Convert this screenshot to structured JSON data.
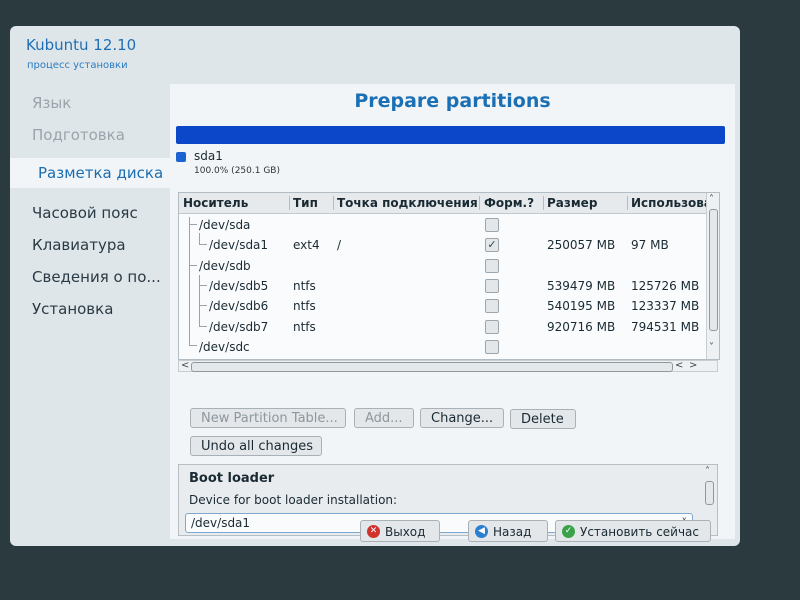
{
  "app": {
    "title": "Kubuntu 12.10",
    "subtitle": "процесс установки"
  },
  "sidebar": {
    "items": [
      {
        "label": "Язык",
        "state": "done"
      },
      {
        "label": "Подготовка",
        "state": "done"
      },
      {
        "label": "Разметка диска",
        "state": "active"
      },
      {
        "label": "Часовой пояс",
        "state": "pending"
      },
      {
        "label": "Клавиатура",
        "state": "pending"
      },
      {
        "label": "Сведения о по...",
        "state": "pending"
      },
      {
        "label": "Установка",
        "state": "pending"
      }
    ]
  },
  "main": {
    "title": "Prepare partitions",
    "usage_bar": {
      "color": "#0c47c9",
      "fill": 1.0
    },
    "legend": {
      "name": "sda1",
      "size": "100.0% (250.1 GB)",
      "color": "#1b63d0"
    },
    "table": {
      "headers": [
        "Носитель",
        "Тип",
        "Точка подключения",
        "Форм.?",
        "Размер",
        "Использова"
      ],
      "rows": [
        {
          "device": "/dev/sda",
          "type": "",
          "mount": "",
          "format": false,
          "size": "",
          "used": ""
        },
        {
          "device": "/dev/sda1",
          "type": "ext4",
          "mount": "/",
          "format": true,
          "size": "250057 MB",
          "used": "97 MB"
        },
        {
          "device": "/dev/sdb",
          "type": "",
          "mount": "",
          "format": false,
          "size": "",
          "used": ""
        },
        {
          "device": "/dev/sdb5",
          "type": "ntfs",
          "mount": "",
          "format": false,
          "size": "539479 MB",
          "used": "125726 MB"
        },
        {
          "device": "/dev/sdb6",
          "type": "ntfs",
          "mount": "",
          "format": false,
          "size": "540195 MB",
          "used": "123337 MB"
        },
        {
          "device": "/dev/sdb7",
          "type": "ntfs",
          "mount": "",
          "format": false,
          "size": "920716 MB",
          "used": "794531 MB"
        },
        {
          "device": "/dev/sdc",
          "type": "",
          "mount": "",
          "format": false,
          "size": "",
          "used": ""
        }
      ]
    },
    "buttons": {
      "new_table": "New Partition Table...",
      "add": "Add...",
      "change": "Change...",
      "delete": "Delete",
      "undo": "Undo all changes"
    },
    "boot_loader": {
      "title": "Boot loader",
      "label": "Device for boot loader installation:",
      "value": "/dev/sda1"
    }
  },
  "footer": {
    "quit": "Выход",
    "back": "Назад",
    "install": "Установить сейчас"
  },
  "icons": {
    "checkmark": "✓",
    "chevron_up": "˄",
    "chevron_down": "˅",
    "chevron_left": "<",
    "chevron_right": ">"
  }
}
